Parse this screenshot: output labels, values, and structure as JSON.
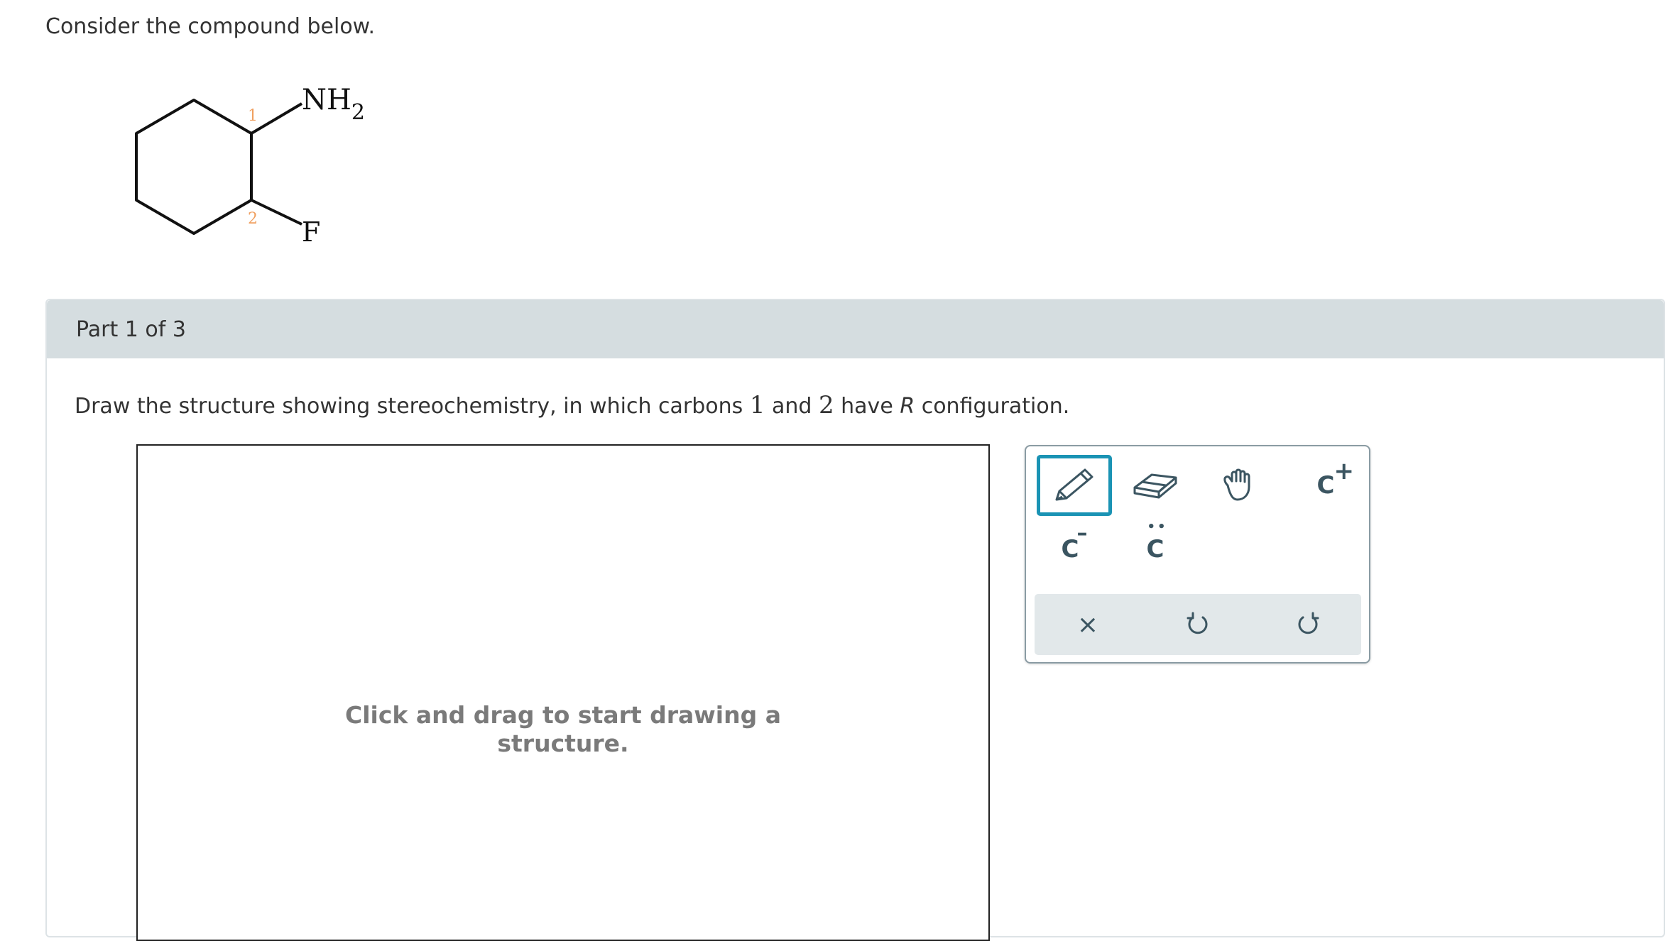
{
  "question": {
    "prompt": "Consider the compound below."
  },
  "molecule": {
    "substituent_top": "NH",
    "substituent_top_subscript": "2",
    "substituent_bottom": "F",
    "carbon_label_1": "1",
    "carbon_label_2": "2",
    "carbon_label_color": "#f0a060"
  },
  "part": {
    "title": "Part 1 of 3",
    "instruction_before": "Draw the structure showing stereochemistry, in which carbons ",
    "instruction_num1": "1",
    "instruction_and": " and ",
    "instruction_num2": "2",
    "instruction_have": " have ",
    "instruction_config": "R",
    "instruction_after": " configuration."
  },
  "canvas": {
    "hint_line1": "Click and drag to start drawing a",
    "hint_line2": "structure."
  },
  "toolbar": {
    "tools": [
      {
        "name": "pencil-icon",
        "active": true
      },
      {
        "name": "eraser-icon",
        "active": false
      },
      {
        "name": "hand-icon",
        "active": false
      },
      {
        "name": "positive-charge",
        "label": "C",
        "superscript": "+"
      },
      {
        "name": "negative-charge",
        "label": "C",
        "superscript": "–"
      },
      {
        "name": "lone-pair",
        "label": "C",
        "dots": "••"
      }
    ],
    "actions": [
      {
        "name": "clear-icon",
        "glyph": "×"
      },
      {
        "name": "undo-icon"
      },
      {
        "name": "redo-icon"
      }
    ],
    "accent_color": "#1a93b4",
    "icon_color": "#3b5561"
  }
}
